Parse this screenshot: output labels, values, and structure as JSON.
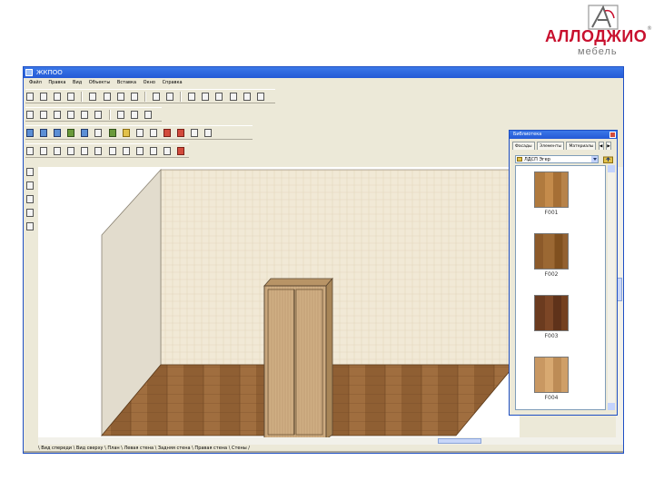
{
  "brand": {
    "logo_text": "АЛЛОДЖИО",
    "logo_reg": "®",
    "logo_sub": "мебель",
    "color": "#c8102e"
  },
  "window": {
    "title": "ЖКПОО",
    "menu": [
      "Файл",
      "Правка",
      "Вид",
      "Объекты",
      "Вставка",
      "Окно",
      "Справка"
    ]
  },
  "toolbar": {
    "zoom_value": ""
  },
  "library": {
    "title": "Библиотека",
    "tabs": [
      "Фасады",
      "Элементы",
      "Материалы"
    ],
    "folder": "ЛДСП Эгер",
    "items": [
      {
        "label": "F001",
        "color": "#b07a3e"
      },
      {
        "label": "F002",
        "color": "#8c5a2a"
      },
      {
        "label": "F003",
        "color": "#6b3b1f"
      },
      {
        "label": "F004",
        "color": "#c99862"
      }
    ]
  },
  "bottom_tabs": "\\ Вид спереди \\ Вид сверху \\ План \\ Левая стена \\ Задняя стена \\ Правая стена \\ Стены /",
  "colors": {
    "titlebar": "#2459d6",
    "wall": "#efe6d2",
    "floor": "#9a6a3c",
    "wardrobe": "#c9a67a"
  }
}
